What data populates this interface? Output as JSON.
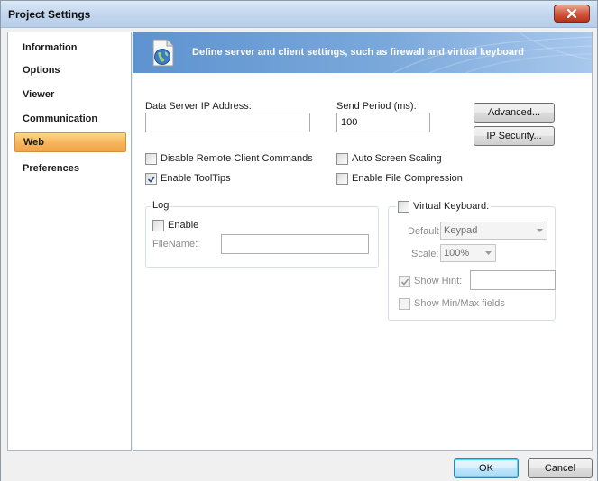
{
  "window": {
    "title": "Project Settings"
  },
  "sidebar": {
    "items": [
      {
        "label": "Information",
        "selected": false
      },
      {
        "label": "Options",
        "selected": false
      },
      {
        "label": "Viewer",
        "selected": false
      },
      {
        "label": "Communication",
        "selected": false
      },
      {
        "label": "Web",
        "selected": true
      },
      {
        "label": "Preferences",
        "selected": false
      }
    ]
  },
  "banner": {
    "icon": "globe-document-icon",
    "text": "Define server and  client settings, such as firewall and virtual keyboard"
  },
  "form": {
    "data_server_ip_label": "Data Server IP Address:",
    "data_server_ip_value": "",
    "send_period_label": "Send Period (ms):",
    "send_period_value": "100",
    "advanced_button": "Advanced...",
    "ip_security_button": "IP Security...",
    "disable_remote_label": "Disable Remote Client Commands",
    "disable_remote_checked": false,
    "enable_tooltips_label": "Enable ToolTips",
    "enable_tooltips_checked": true,
    "auto_screen_scaling_label": "Auto Screen Scaling",
    "auto_screen_scaling_checked": false,
    "enable_file_compression_label": "Enable File Compression",
    "enable_file_compression_checked": false
  },
  "log": {
    "title": "Log",
    "enable_label": "Enable",
    "enable_checked": false,
    "filename_label": "FileName:",
    "filename_value": ""
  },
  "virtual_keyboard": {
    "title": "Virtual Keyboard:",
    "checked": false,
    "default_label": "Default:",
    "default_value": "Keypad",
    "scale_label": "Scale:",
    "scale_value": "100%",
    "show_hint_label": "Show Hint:",
    "show_hint_checked": true,
    "show_hint_value": "",
    "show_minmax_label": "Show Min/Max fields",
    "show_minmax_checked": false
  },
  "footer": {
    "ok_label": "OK",
    "cancel_label": "Cancel"
  },
  "colors": {
    "selected_nav": "#f6b35a",
    "banner": "#6f9fd6",
    "close_button": "#c9452a"
  }
}
